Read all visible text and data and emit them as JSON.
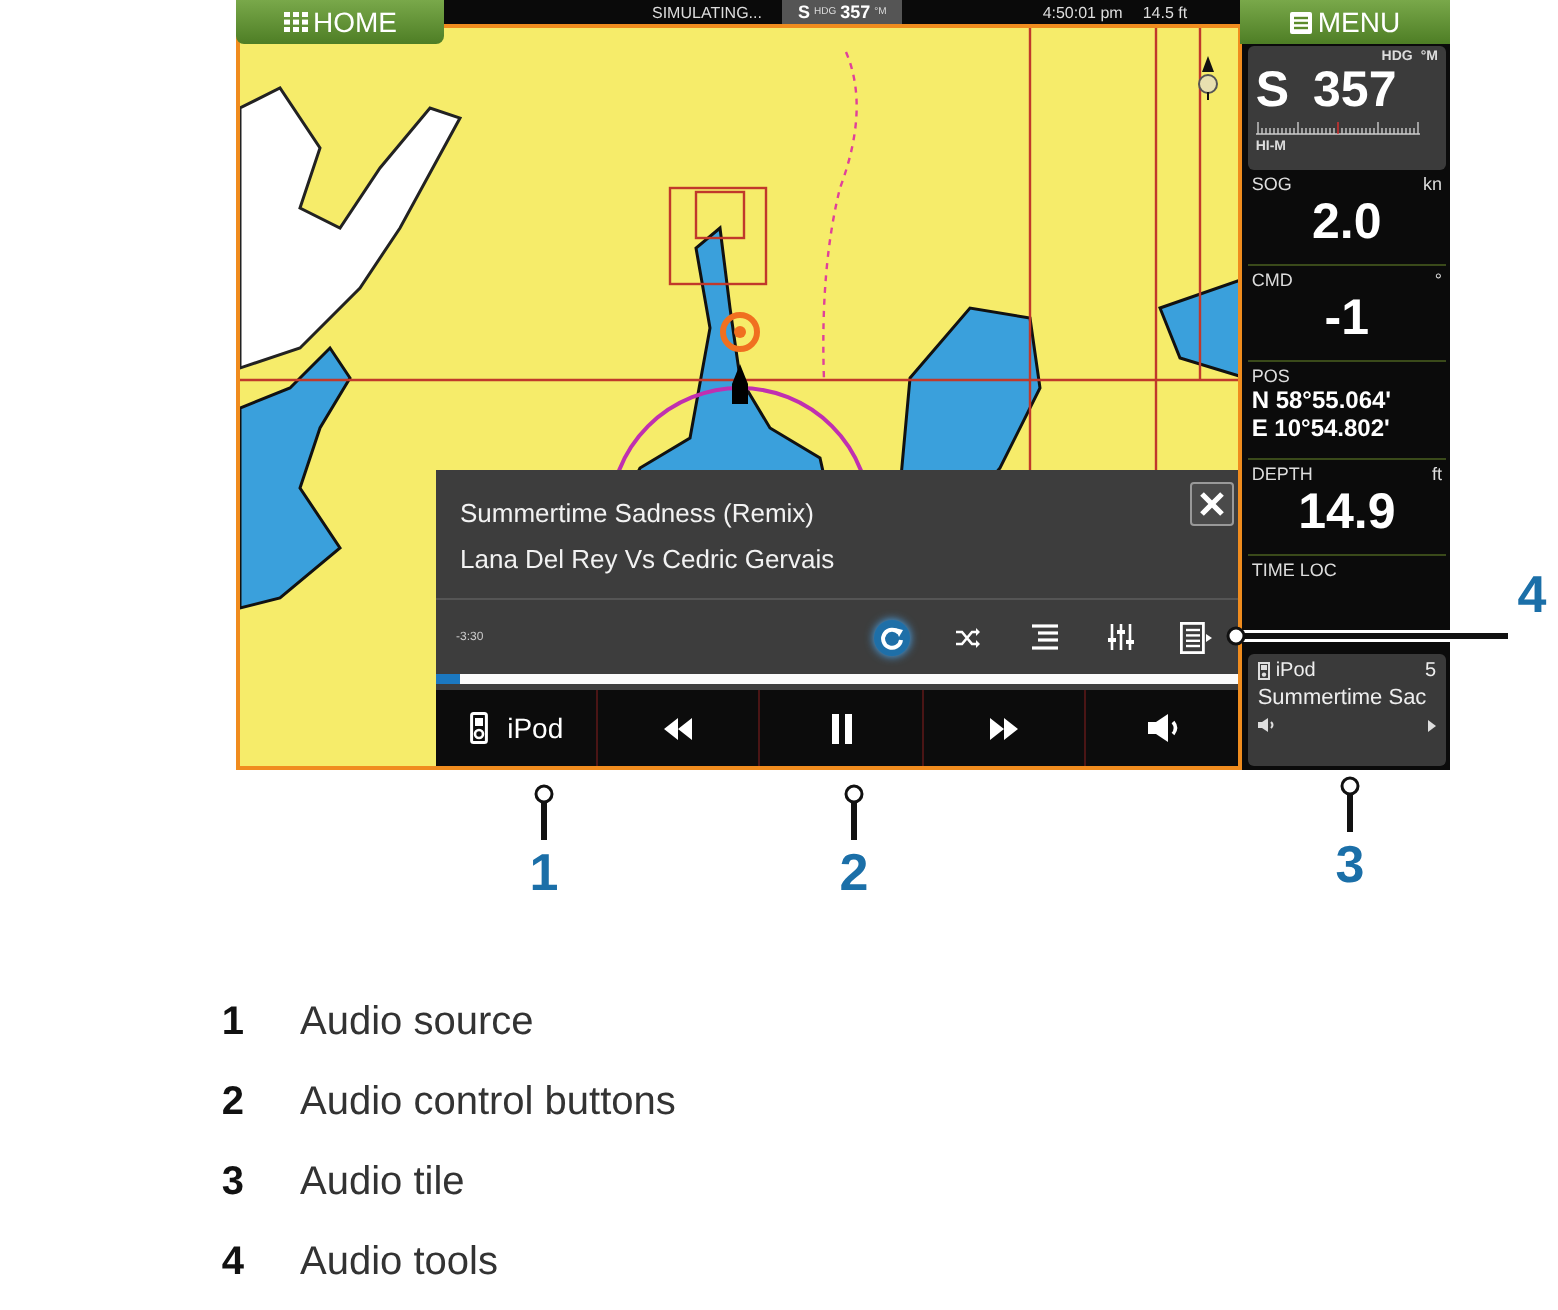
{
  "top_bar": {
    "home_button": "HOME",
    "status": "SIMULATING...",
    "heading": {
      "direction": "S",
      "label": "HDG",
      "value": "357",
      "unit": "°M"
    },
    "time": "4:50:01 pm",
    "depth": "14.5 ft",
    "menu_button": "MENU"
  },
  "sidebar": {
    "compass": {
      "label": "HDG",
      "unit": "°M",
      "direction": "S",
      "value": "357",
      "mode": "HI-M"
    },
    "tiles": [
      {
        "kind": "value",
        "label": "SOG",
        "unit": "kn",
        "value": "2.0"
      },
      {
        "kind": "value",
        "label": "CMD",
        "unit": "°",
        "value": "-1"
      },
      {
        "kind": "position",
        "label": "POS",
        "lines": [
          "N  58°55.064'",
          "E  10°54.802'"
        ]
      },
      {
        "kind": "value",
        "label": "DEPTH",
        "unit": "ft",
        "value": "14.9"
      },
      {
        "kind": "value",
        "label": "TIME LOC"
      }
    ],
    "audio_tile": {
      "source": "iPod",
      "number": "5",
      "track": "Summertime Sac"
    }
  },
  "audio_player": {
    "title": "Summertime Sadness (Remix)",
    "artist": "Lana Del Rey Vs Cedric Gervais",
    "time": "-3:30",
    "tools": [
      {
        "kind": "repeat",
        "selected": true
      },
      {
        "kind": "shuffle",
        "selected": false
      },
      {
        "kind": "playlist",
        "selected": false
      },
      {
        "kind": "equalizer",
        "selected": false
      },
      {
        "kind": "menu",
        "selected": false
      }
    ],
    "progress": {
      "level": 0.03
    },
    "source": "iPod",
    "controls": [
      {
        "kind": "rewind"
      },
      {
        "kind": "pause"
      },
      {
        "kind": "forward"
      },
      {
        "kind": "volume"
      }
    ]
  },
  "callouts": [
    {
      "number": "1",
      "kind": "source"
    },
    {
      "number": "2",
      "kind": "controls"
    },
    {
      "number": "3",
      "kind": "tile"
    },
    {
      "number": "4",
      "kind": "tools"
    }
  ],
  "legend": [
    {
      "number": "1",
      "text": "Audio source"
    },
    {
      "number": "2",
      "text": "Audio control buttons"
    },
    {
      "number": "3",
      "text": "Audio tile"
    },
    {
      "number": "4",
      "text": "Audio tools"
    }
  ]
}
